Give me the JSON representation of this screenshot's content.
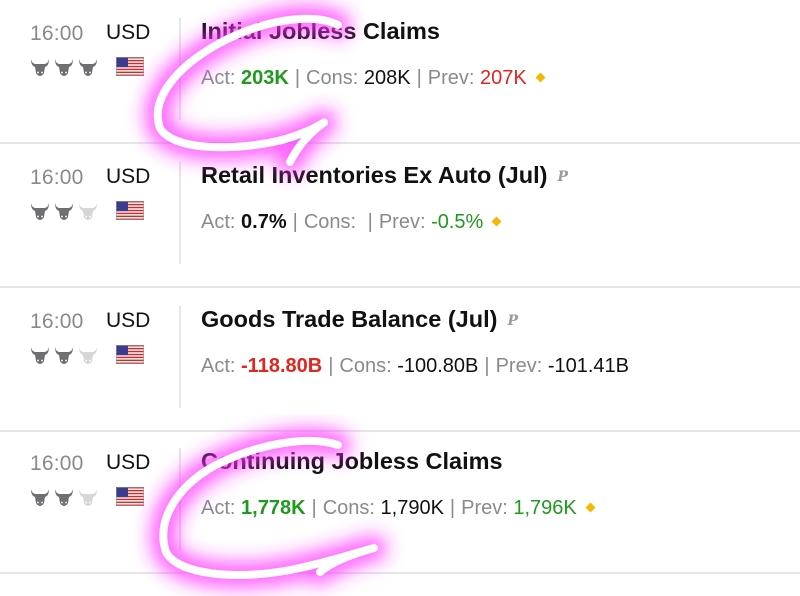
{
  "events": [
    {
      "time": "16:00",
      "currency": "USD",
      "title": "Initial Jobless Claims",
      "preliminary": "",
      "actual_label": "Act:",
      "actual": "203K",
      "cons_label": "Cons:",
      "consensus": "208K",
      "prev_label": "Prev:",
      "previous": "207K",
      "importance": 3,
      "revised": true
    },
    {
      "time": "16:00",
      "currency": "USD",
      "title": "Retail Inventories Ex Auto (Jul)",
      "preliminary": "P",
      "actual_label": "Act:",
      "actual": "0.7%",
      "cons_label": "Cons:",
      "consensus": "",
      "prev_label": "Prev:",
      "previous": "-0.5%",
      "importance": 2,
      "revised": true
    },
    {
      "time": "16:00",
      "currency": "USD",
      "title": "Goods Trade Balance (Jul)",
      "preliminary": "P",
      "actual_label": "Act:",
      "actual": "-118.80B",
      "cons_label": "Cons:",
      "consensus": "-100.80B",
      "prev_label": "Prev:",
      "previous": "-101.41B",
      "importance": 2,
      "revised": false
    },
    {
      "time": "16:00",
      "currency": "USD",
      "title": "Continuing Jobless Claims",
      "preliminary": "",
      "actual_label": "Act:",
      "actual": "1,778K",
      "cons_label": "Cons:",
      "consensus": "1,790K",
      "prev_label": "Prev:",
      "previous": "1,796K",
      "importance": 2,
      "revised": true
    }
  ],
  "icons": {
    "importance": "bull-icon",
    "country": "us-flag-icon",
    "preliminary": "preliminary-icon",
    "revised": "revised-diamond-icon"
  },
  "colors": {
    "positive": "#1f9a1f",
    "negative": "#e0261f",
    "bull_active": "#6e6e73",
    "bull_inactive": "#d6d6d9",
    "diamond": "#f5b800",
    "highlight": "#ff2bff"
  }
}
